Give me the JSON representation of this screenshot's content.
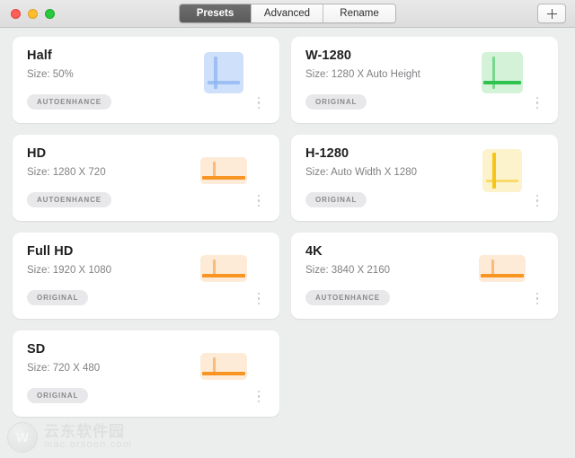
{
  "window": {
    "traffic_lights": [
      "close",
      "minimize",
      "maximize"
    ],
    "tabs": [
      {
        "label": "Presets",
        "active": true
      },
      {
        "label": "Advanced",
        "active": false
      },
      {
        "label": "Rename",
        "active": false
      }
    ],
    "add_button_icon": "plus-icon"
  },
  "presets": [
    {
      "title": "Half",
      "size": "Size: 50%",
      "badge": "AUTOENHANCE",
      "thumb": {
        "shape": "square",
        "bg": "#cfe0fb",
        "line": "#8cb4f0",
        "emphasis": "both",
        "w": 44,
        "h": 46
      }
    },
    {
      "title": "W-1280",
      "size": "Size: 1280 X Auto Height",
      "badge": "ORIGINAL",
      "thumb": {
        "shape": "square",
        "bg": "#d4f2d8",
        "line": "#2ec24f",
        "emphasis": "horizontal",
        "w": 46,
        "h": 46
      }
    },
    {
      "title": "HD",
      "size": "Size: 1280 X 720",
      "badge": "AUTOENHANCE",
      "thumb": {
        "shape": "wide",
        "bg": "#fdebd7",
        "line": "#f89422",
        "emphasis": "horizontal",
        "w": 52,
        "h": 30
      }
    },
    {
      "title": "H-1280",
      "size": "Size: Auto Width X 1280",
      "badge": "ORIGINAL",
      "thumb": {
        "shape": "tall",
        "bg": "#fcf3cd",
        "line": "#f5c518",
        "emphasis": "vertical",
        "w": 44,
        "h": 48
      }
    },
    {
      "title": "Full HD",
      "size": "Size: 1920 X 1080",
      "badge": "ORIGINAL",
      "thumb": {
        "shape": "wide",
        "bg": "#fdebd7",
        "line": "#f89422",
        "emphasis": "horizontal",
        "w": 52,
        "h": 30
      }
    },
    {
      "title": "4K",
      "size": "Size: 3840 X 2160",
      "badge": "AUTOENHANCE",
      "thumb": {
        "shape": "wide",
        "bg": "#fdebd7",
        "line": "#f89422",
        "emphasis": "horizontal",
        "w": 52,
        "h": 30
      }
    },
    {
      "title": "SD",
      "size": "Size: 720 X 480",
      "badge": "ORIGINAL",
      "thumb": {
        "shape": "wide",
        "bg": "#fdebd7",
        "line": "#f89422",
        "emphasis": "horizontal",
        "w": 52,
        "h": 30
      }
    }
  ],
  "watermark": {
    "logo_letter": "W",
    "title_cn": "云东软件园",
    "url": "mac.orsoon.com"
  },
  "colors": {
    "window_bg": "#eceded",
    "card_bg": "#ffffff",
    "title_text": "#1f1f1f",
    "muted_text": "#808184",
    "badge_bg": "#e8e8ea",
    "badge_text": "#8a8a8e",
    "tab_active_bg": "#5f5f5f"
  }
}
